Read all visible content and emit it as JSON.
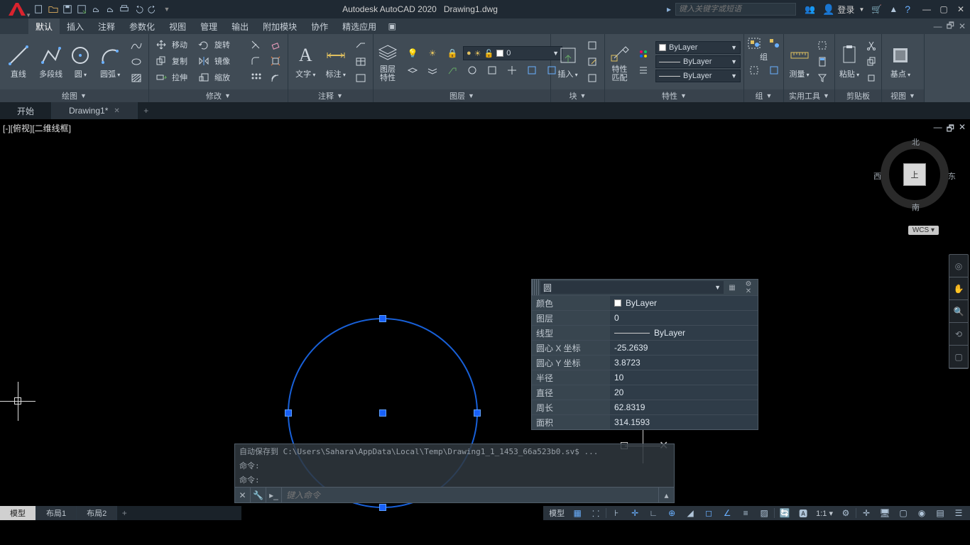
{
  "title": {
    "app": "Autodesk AutoCAD 2020",
    "file": "Drawing1.dwg"
  },
  "search_placeholder": "键入关键字或短语",
  "login_label": "登录",
  "menus": [
    "默认",
    "插入",
    "注释",
    "参数化",
    "视图",
    "管理",
    "输出",
    "附加模块",
    "协作",
    "精选应用"
  ],
  "ribbon": {
    "draw": {
      "title": "绘图",
      "line": "直线",
      "polyline": "多段线",
      "circle": "圆",
      "arc": "圆弧"
    },
    "modify": {
      "title": "修改",
      "move": "移动",
      "rotate": "旋转",
      "copy": "复制",
      "mirror": "镜像",
      "stretch": "拉伸",
      "scale": "缩放"
    },
    "annotate": {
      "title": "注释",
      "text": "文字",
      "dim": "标注"
    },
    "layers": {
      "title": "图层",
      "props": "图层\n特性",
      "current": "0"
    },
    "block": {
      "title": "块",
      "insert": "插入"
    },
    "props": {
      "title": "特性",
      "match": "特性\n匹配",
      "color": "ByLayer",
      "lw": "ByLayer",
      "lt": "ByLayer"
    },
    "group": {
      "title": "组",
      "label": "组"
    },
    "utils": {
      "title": "实用工具",
      "measure": "测量"
    },
    "clipboard": {
      "title": "剪贴板",
      "paste": "粘贴"
    },
    "view": {
      "title": "视图",
      "base": "基点"
    }
  },
  "doc_tabs": {
    "start": "开始",
    "drawing": "Drawing1*"
  },
  "viewport_label": "[-][俯视][二维线框]",
  "quickprops": {
    "type": "圆",
    "rows": [
      {
        "k": "颜色",
        "v": "ByLayer",
        "swatch": true
      },
      {
        "k": "图层",
        "v": "0"
      },
      {
        "k": "线型",
        "v": "ByLayer",
        "line": true
      },
      {
        "k": "圆心 X 坐标",
        "v": "-25.2639"
      },
      {
        "k": "圆心 Y 坐标",
        "v": "3.8723"
      },
      {
        "k": "半径",
        "v": "10"
      },
      {
        "k": "直径",
        "v": "20"
      },
      {
        "k": "周长",
        "v": "62.8319"
      },
      {
        "k": "面积",
        "v": "314.1593"
      }
    ]
  },
  "viewcube": {
    "top": "上",
    "n": "北",
    "s": "南",
    "e": "东",
    "w": "西"
  },
  "wcs": "WCS",
  "cmd": {
    "history": [
      "自动保存到 C:\\Users\\Sahara\\AppData\\Local\\Temp\\Drawing1_1_1453_66a523b0.sv$ ...",
      "命令:",
      "命令:"
    ],
    "placeholder": "键入命令"
  },
  "layouts": [
    "模型",
    "布局1",
    "布局2"
  ],
  "status": {
    "space": "模型",
    "scale": "1:1"
  }
}
